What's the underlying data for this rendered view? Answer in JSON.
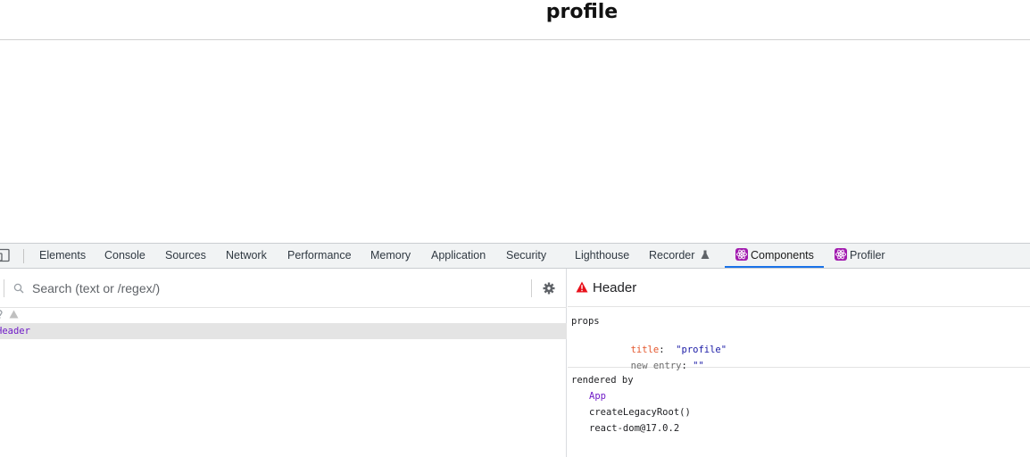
{
  "page": {
    "title": "profile"
  },
  "devtools": {
    "tabs": [
      {
        "label": "Elements"
      },
      {
        "label": "Console"
      },
      {
        "label": "Sources"
      },
      {
        "label": "Network"
      },
      {
        "label": "Performance"
      },
      {
        "label": "Memory"
      },
      {
        "label": "Application"
      },
      {
        "label": "Security"
      },
      {
        "label": "Lighthouse"
      },
      {
        "label": "Recorder"
      },
      {
        "label": "Components"
      },
      {
        "label": "Profiler"
      }
    ],
    "active_tab": "Components",
    "accent_color": "#1a73e8"
  },
  "components_panel": {
    "search": {
      "placeholder": "Search (text or /regex/)"
    },
    "tree": {
      "selected_label": "Header"
    },
    "inspector": {
      "component_name": "Header",
      "props_title": "props",
      "props": [
        {
          "key": "title",
          "sep": ":",
          "value": "\"profile\""
        },
        {
          "key": "new entry",
          "sep": ":",
          "value": "\"\""
        }
      ],
      "rendered_by_title": "rendered by",
      "rendered_by": [
        {
          "label": "App"
        },
        {
          "label": "createLegacyRoot()"
        },
        {
          "label": "react-dom@17.0.2"
        }
      ]
    }
  }
}
